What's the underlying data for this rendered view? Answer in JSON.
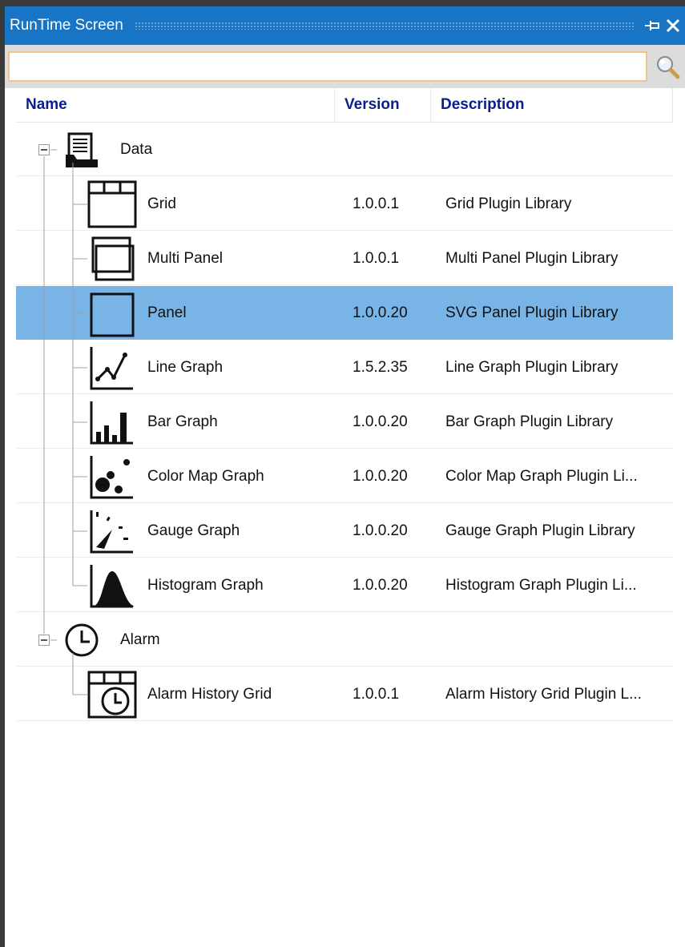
{
  "panel": {
    "title": "RunTime Screen"
  },
  "search": {
    "value": "",
    "placeholder": ""
  },
  "columns": {
    "name": "Name",
    "version": "Version",
    "description": "Description"
  },
  "groups": [
    {
      "name": "Data",
      "icon": "data-document-icon",
      "children": [
        {
          "name": "Grid",
          "version": "1.0.0.1",
          "description": "Grid Plugin Library",
          "icon": "grid-icon"
        },
        {
          "name": "Multi Panel",
          "version": "1.0.0.1",
          "description": "Multi Panel Plugin Library",
          "icon": "multi-panel-icon"
        },
        {
          "name": "Panel",
          "version": "1.0.0.20",
          "description": "SVG Panel Plugin Library",
          "icon": "panel-icon",
          "selected": true
        },
        {
          "name": "Line Graph",
          "version": "1.5.2.35",
          "description": "Line Graph Plugin Library",
          "icon": "line-graph-icon"
        },
        {
          "name": "Bar Graph",
          "version": "1.0.0.20",
          "description": "Bar Graph Plugin Library",
          "icon": "bar-graph-icon"
        },
        {
          "name": "Color Map Graph",
          "version": "1.0.0.20",
          "description": "Color Map Graph Plugin Li...",
          "icon": "color-map-graph-icon"
        },
        {
          "name": "Gauge Graph",
          "version": "1.0.0.20",
          "description": "Gauge Graph Plugin Library",
          "icon": "gauge-graph-icon"
        },
        {
          "name": "Histogram Graph",
          "version": "1.0.0.20",
          "description": "Histogram Graph Plugin Li...",
          "icon": "histogram-graph-icon"
        }
      ]
    },
    {
      "name": "Alarm",
      "icon": "clock-icon",
      "children": [
        {
          "name": "Alarm History Grid",
          "version": "1.0.0.1",
          "description": "Alarm History Grid Plugin L...",
          "icon": "alarm-history-grid-icon"
        }
      ]
    }
  ],
  "colors": {
    "titlebar": "#1874c4",
    "header_text": "#0b1d8c",
    "selection": "#79b4e6",
    "search_border": "#f0c48c"
  }
}
